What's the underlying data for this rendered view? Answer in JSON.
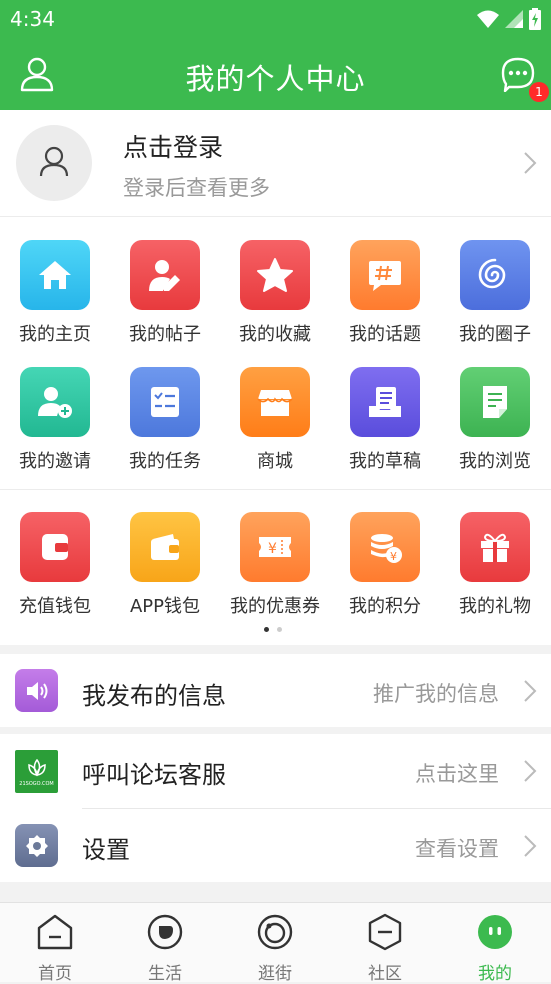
{
  "status_bar": {
    "time": "4:34"
  },
  "header": {
    "title": "我的个人中心",
    "message_badge": "1"
  },
  "login": {
    "title": "点击登录",
    "subtitle": "登录后查看更多"
  },
  "grid_primary": [
    {
      "label": "我的主页",
      "icon": "home-icon",
      "color": "#2fc6f0"
    },
    {
      "label": "我的帖子",
      "icon": "post-edit-icon",
      "color": "#f0474a"
    },
    {
      "label": "我的收藏",
      "icon": "star-icon",
      "color": "#f0474a"
    },
    {
      "label": "我的话题",
      "icon": "hashtag-icon",
      "color": "#ff8a3d"
    },
    {
      "label": "我的圈子",
      "icon": "spiral-icon",
      "color": "#5b7fe8"
    },
    {
      "label": "我的邀请",
      "icon": "invite-user-icon",
      "color": "#2ec4a0"
    },
    {
      "label": "我的任务",
      "icon": "task-list-icon",
      "color": "#5b84e0"
    },
    {
      "label": "商城",
      "icon": "store-icon",
      "color": "#ff8a2a"
    },
    {
      "label": "我的草稿",
      "icon": "draft-icon",
      "color": "#6b5ce7"
    },
    {
      "label": "我的浏览",
      "icon": "browse-doc-icon",
      "color": "#4cbf62"
    }
  ],
  "grid_secondary": [
    {
      "label": "充值钱包",
      "icon": "wallet-icon",
      "color": "#f0474a"
    },
    {
      "label": "APP钱包",
      "icon": "app-wallet-icon",
      "color": "#fbb42a"
    },
    {
      "label": "我的优惠券",
      "icon": "coupon-icon",
      "color": "#ff8a3d"
    },
    {
      "label": "我的积分",
      "icon": "points-icon",
      "color": "#ff8a3d"
    },
    {
      "label": "我的礼物",
      "icon": "gift-icon",
      "color": "#f0474a"
    }
  ],
  "list": [
    {
      "label": "我发布的信息",
      "right": "推广我的信息",
      "icon": "speaker-icon",
      "color": "#b86be0"
    },
    {
      "label": "呼叫论坛客服",
      "right": "点击这里",
      "icon": "forum-logo-icon",
      "color": "#2b9e38",
      "logo_text": "21SOGO.COM"
    },
    {
      "label": "设置",
      "right": "查看设置",
      "icon": "settings-icon",
      "color": "#6c7a99"
    }
  ],
  "tabs": [
    {
      "label": "首页",
      "icon": "home-tab-icon"
    },
    {
      "label": "生活",
      "icon": "life-tab-icon"
    },
    {
      "label": "逛街",
      "icon": "shopping-tab-icon"
    },
    {
      "label": "社区",
      "icon": "community-tab-icon"
    },
    {
      "label": "我的",
      "icon": "me-tab-icon"
    }
  ],
  "theme": {
    "primary": "#3cba4f",
    "badge": "#ff2a2a"
  }
}
